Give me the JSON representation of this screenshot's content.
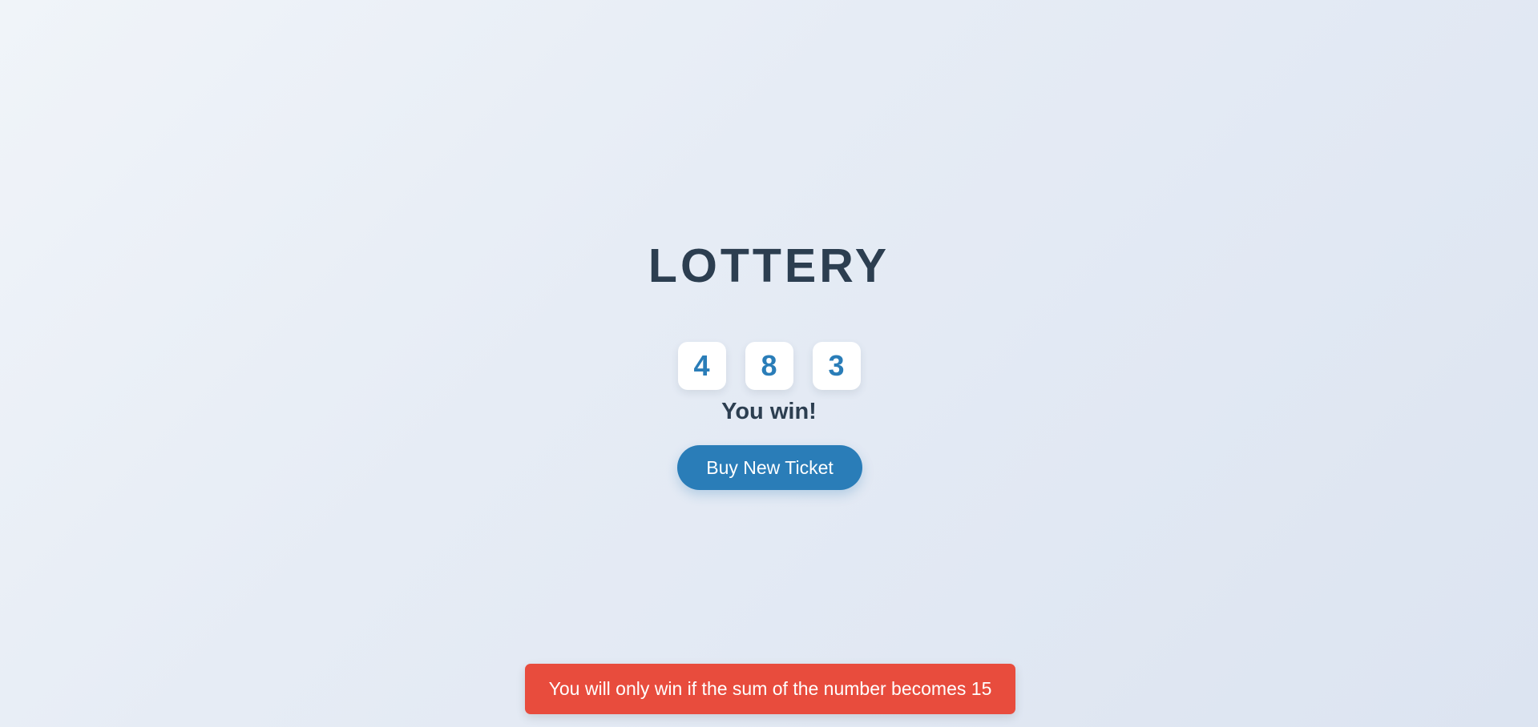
{
  "title": "LOTTERY",
  "numbers": [
    "4",
    "8",
    "3"
  ],
  "result_text": "You win!",
  "buy_button_label": "Buy New Ticket",
  "toast_message": "You will only win if the sum of the number becomes 15",
  "colors": {
    "title": "#2c3e50",
    "number": "#2a7db8",
    "button": "#2a7db8",
    "toast": "#e84c3d"
  }
}
